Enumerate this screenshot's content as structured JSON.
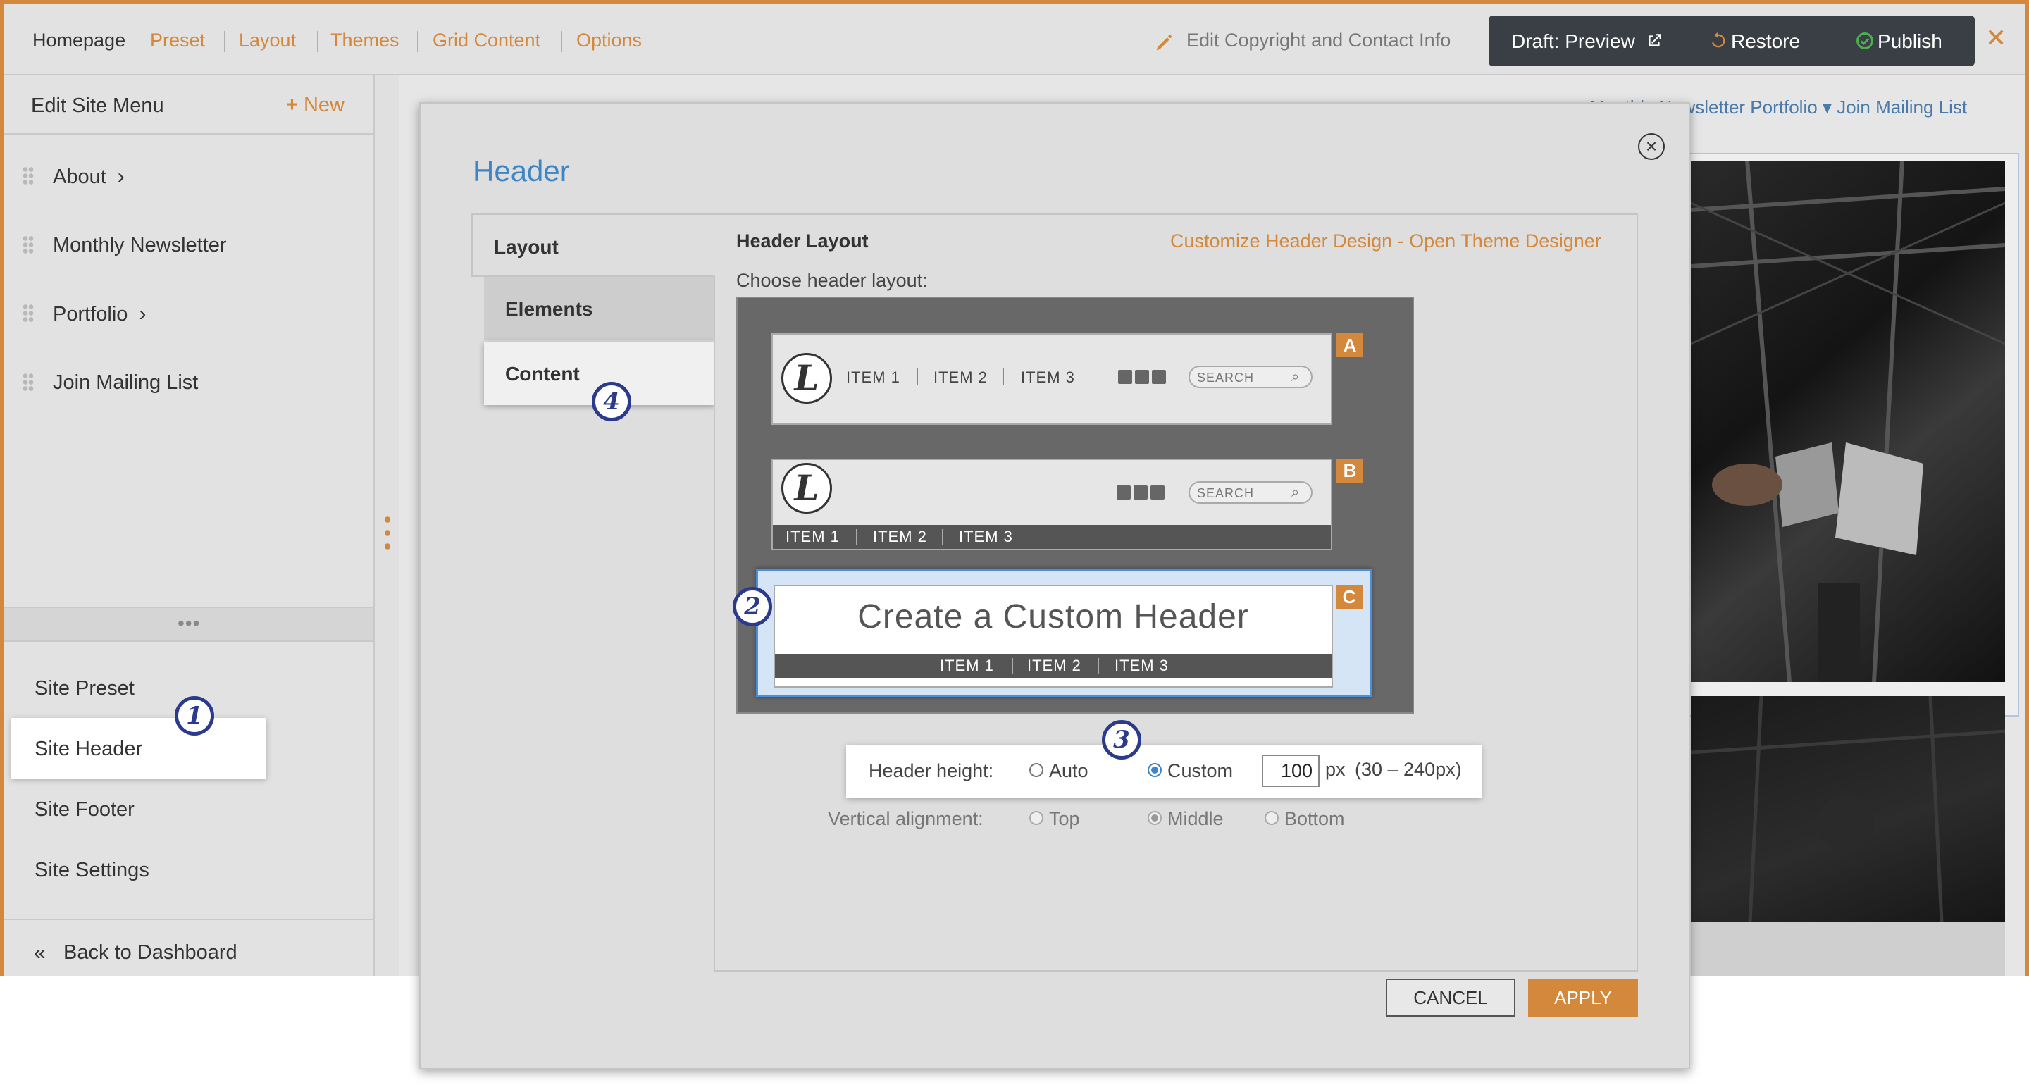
{
  "topbar": {
    "nav": [
      "Homepage",
      "Preset",
      "Layout",
      "Themes",
      "Grid Content",
      "Options"
    ],
    "edit_copyright": "Edit Copyright and Contact Info",
    "draft_preview": "Draft: Preview",
    "restore": "Restore",
    "publish": "Publish",
    "close": "✕"
  },
  "sidebar": {
    "title": "Edit Site Menu",
    "new_label": "New",
    "menu_items": [
      "About",
      "Monthly Newsletter",
      "Portfolio",
      "Join Mailing List"
    ],
    "site_items": [
      "Site Preset",
      "Site Header",
      "Site Footer",
      "Site Settings"
    ],
    "selected": "Site Header",
    "back": "Back to Dashboard"
  },
  "preview": {
    "nav": "Monthly Newsletter     Portfolio ▾     Join Mailing List"
  },
  "modal": {
    "title": "Header",
    "tabs": [
      "Layout",
      "Elements",
      "Content"
    ],
    "section_title": "Header Layout",
    "customize_link": "Customize Header Design - Open Theme Designer",
    "choose_label": "Choose header layout:",
    "options": {
      "a_badge": "A",
      "b_badge": "B",
      "c_badge": "C",
      "logo_letter": "L",
      "items": [
        "ITEM 1",
        "ITEM 2",
        "ITEM 3"
      ],
      "search": "SEARCH",
      "custom_text": "Create a Custom Header"
    },
    "height_label": "Header height:",
    "height_auto": "Auto",
    "height_custom": "Custom",
    "height_value": "100",
    "height_unit": "px",
    "height_range": "(30 – 240px)",
    "valign_label": "Vertical alignment:",
    "valign_top": "Top",
    "valign_middle": "Middle",
    "valign_bottom": "Bottom",
    "cancel": "CANCEL",
    "apply": "APPLY"
  },
  "steps": [
    "1",
    "2",
    "3",
    "4"
  ],
  "colors": {
    "accent": "#d4883c",
    "title_blue": "#3d86c6",
    "step_navy": "#2b3a8c"
  }
}
